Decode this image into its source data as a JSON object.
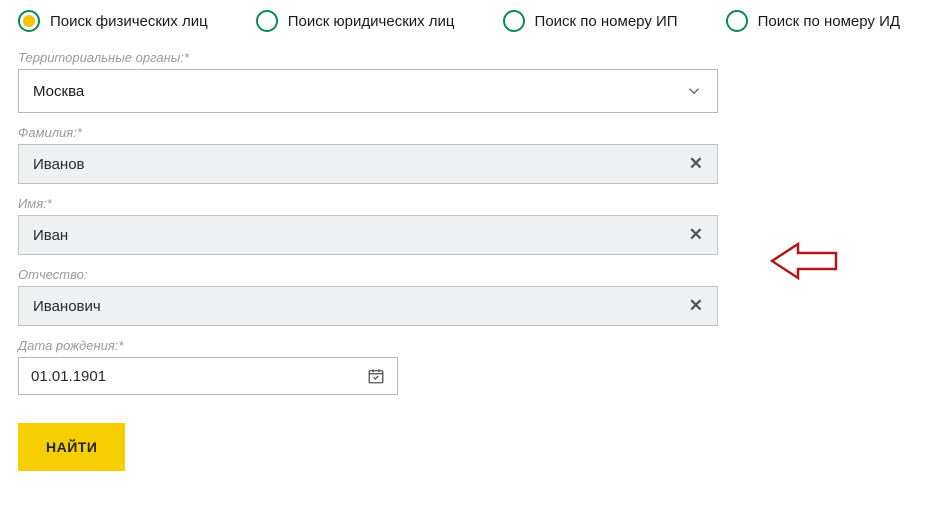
{
  "tabs": [
    {
      "label": "Поиск физических лиц",
      "selected": true
    },
    {
      "label": "Поиск юридических лиц",
      "selected": false
    },
    {
      "label": "Поиск по номеру ИП",
      "selected": false
    },
    {
      "label": "Поиск по номеру ИД",
      "selected": false
    }
  ],
  "fields": {
    "territory": {
      "label": "Территориальные органы:*",
      "value": "Москва"
    },
    "surname": {
      "label": "Фамилия:*",
      "value": "Иванов"
    },
    "name": {
      "label": "Имя:*",
      "value": "Иван"
    },
    "patronymic": {
      "label": "Отчество:",
      "value": "Иванович"
    },
    "birthdate": {
      "label": "Дата рождения:*",
      "value": "01.01.1901"
    }
  },
  "buttons": {
    "submit": "НАЙТИ"
  }
}
